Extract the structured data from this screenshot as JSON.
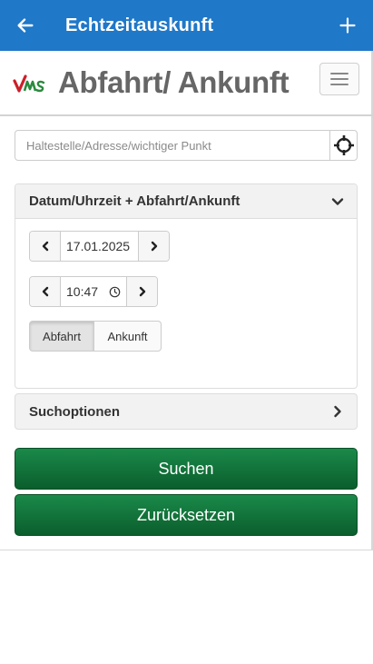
{
  "appbar": {
    "title": "Echtzeitauskunft",
    "back_icon": "arrow-left-icon",
    "add_icon": "plus-icon",
    "color": "#1f78c8"
  },
  "header": {
    "logo_text": "VMS",
    "title": "Abfahrt/ Ankunft",
    "menu_icon": "hamburger-icon"
  },
  "search": {
    "placeholder": "Haltestelle/Adresse/wichtiger Punkt",
    "value": "",
    "locate_icon": "crosshair-icon"
  },
  "datetime_panel": {
    "title": "Datum/Uhrzeit + Abfahrt/Ankunft",
    "date": "17.01.2025",
    "time": "10:47",
    "mode_options": [
      "Abfahrt",
      "Ankunft"
    ],
    "selected_mode": "Abfahrt"
  },
  "options_panel": {
    "title": "Suchoptionen"
  },
  "actions": {
    "search_label": "Suchen",
    "reset_label": "Zurücksetzen",
    "button_color": "#0b6b34"
  }
}
